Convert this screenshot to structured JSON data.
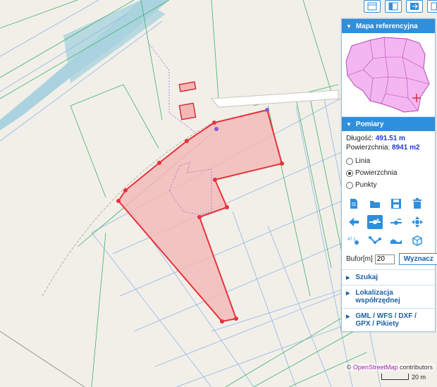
{
  "colors": {
    "accent": "#2e8fdc",
    "measure_value": "#1f39c9",
    "polygon_stroke": "#e8323b",
    "polygon_fill": "#f3b8b6"
  },
  "toolbar": {
    "icons": [
      "layout-icon",
      "split-panel-icon",
      "export-icon",
      "sidebar-toggle-icon"
    ]
  },
  "panels": {
    "ref_map_title": "Mapa referencyjna",
    "pomiary_title": "Pomiary"
  },
  "measure": {
    "length_label": "Długość:",
    "length_value": "491.51 m",
    "area_label": "Powierzchnia:",
    "area_value": "8941 m2"
  },
  "modes": {
    "linia": "Linia",
    "powierzchnia": "Powierzchnia",
    "punkty": "Punkty",
    "selected": "Powierzchnia"
  },
  "buffer": {
    "label": "Bufor[m]",
    "value": "20",
    "button": "Wyznacz"
  },
  "sections": [
    "Szukaj",
    "Lokalizacja współrzędnej",
    "GML / WFS / DXF / GPX / Pikiety"
  ],
  "attribution": {
    "prefix": "© ",
    "osm": "OpenStreetMap",
    "suffix": " contributors"
  },
  "scale": {
    "label": "20 m"
  }
}
